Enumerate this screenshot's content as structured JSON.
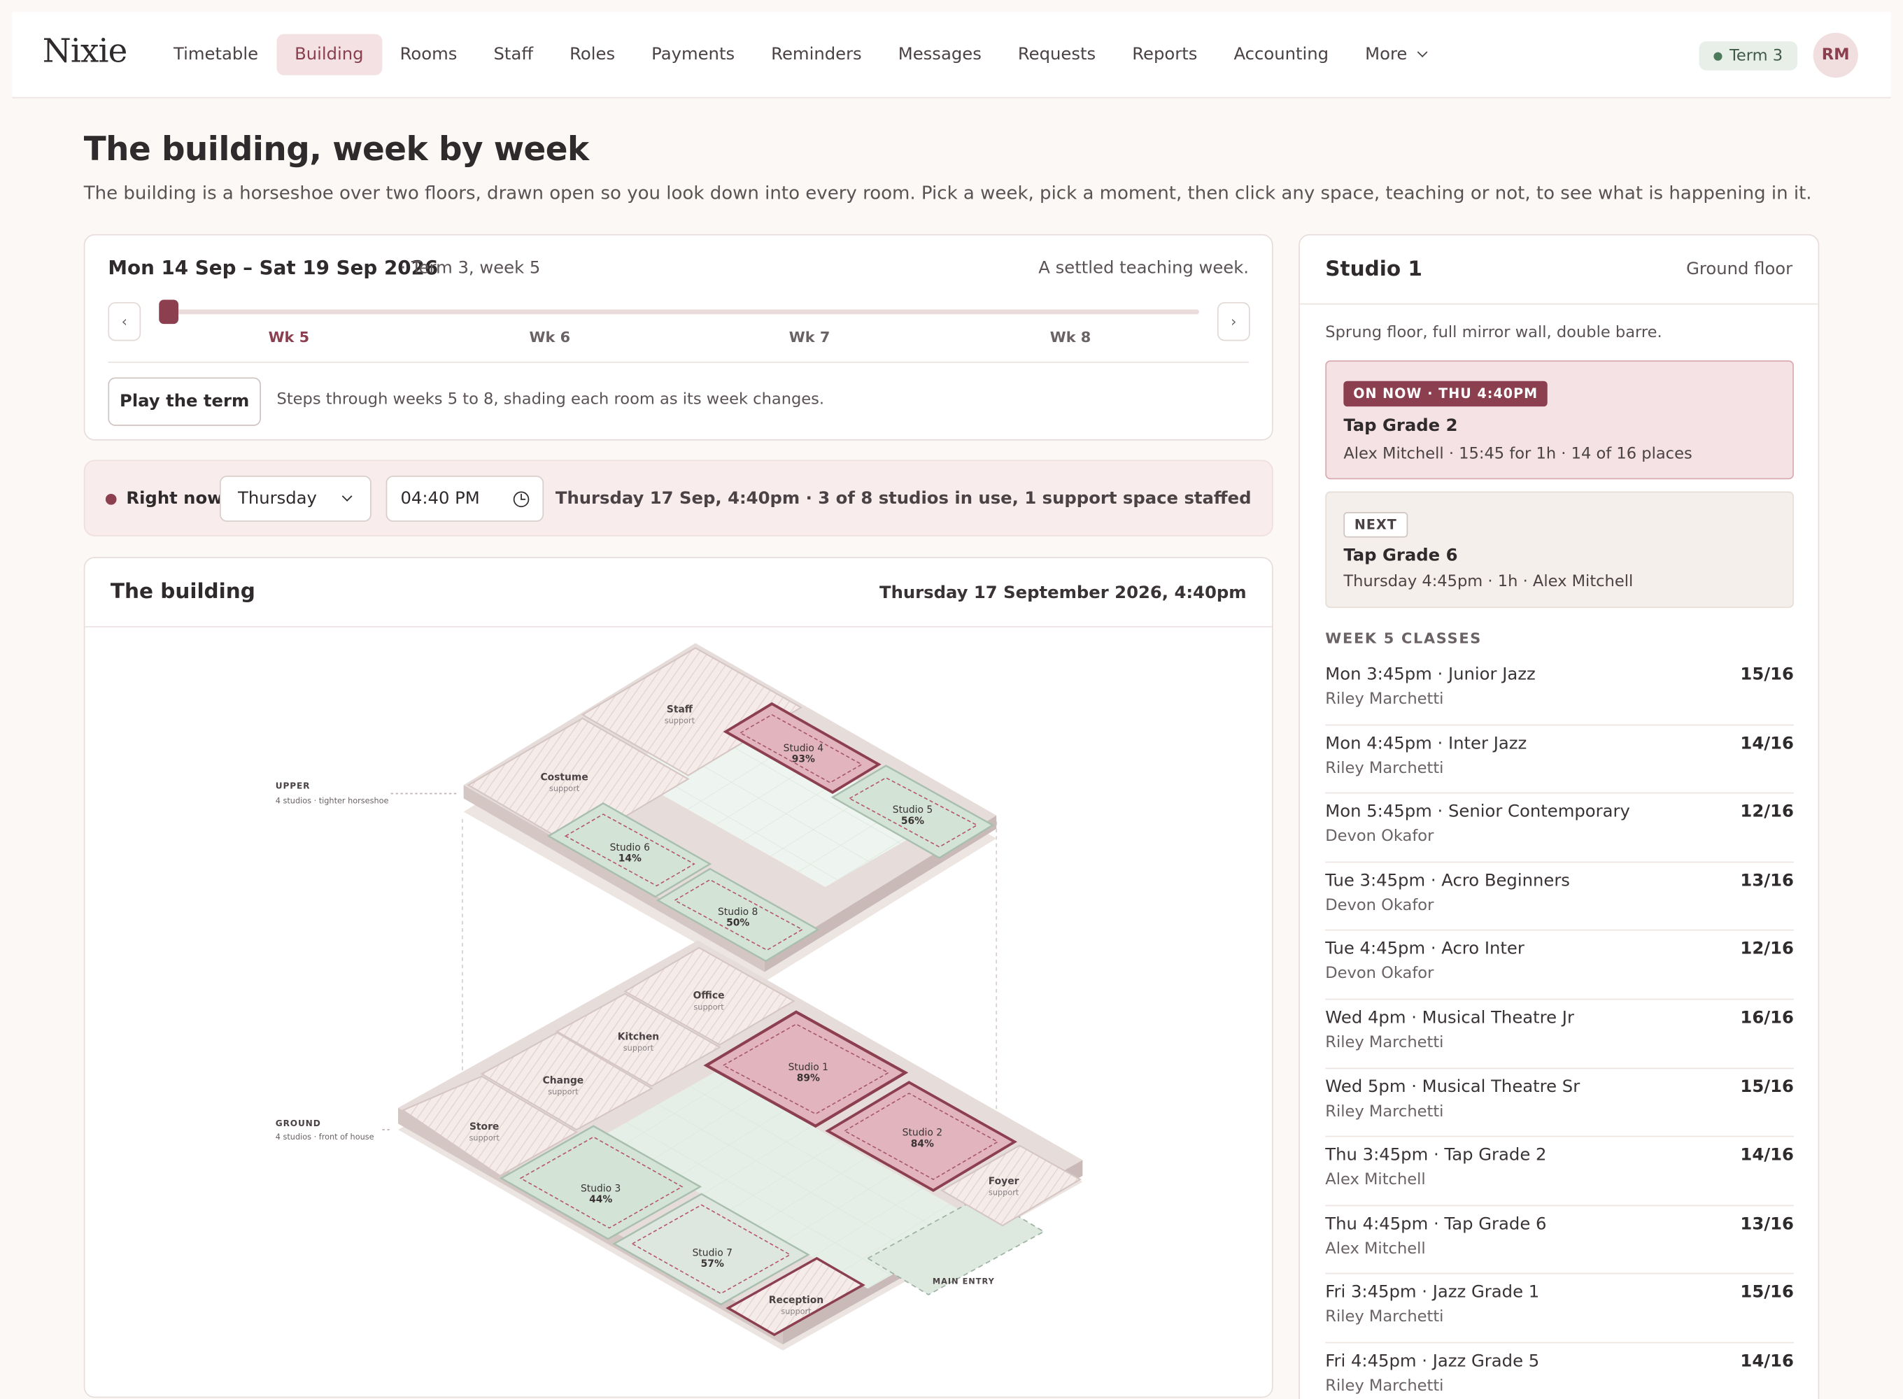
{
  "nav": {
    "brand": "Nixie",
    "items": [
      {
        "label": "Timetable",
        "active": false
      },
      {
        "label": "Building",
        "active": true
      },
      {
        "label": "Rooms",
        "active": false
      },
      {
        "label": "Staff",
        "active": false
      },
      {
        "label": "Roles",
        "active": false
      },
      {
        "label": "Payments",
        "active": false
      },
      {
        "label": "Reminders",
        "active": false
      },
      {
        "label": "Messages",
        "active": false
      },
      {
        "label": "Requests",
        "active": false
      },
      {
        "label": "Reports",
        "active": false
      },
      {
        "label": "Accounting",
        "active": false
      }
    ],
    "more_label": "More",
    "term_badge": "Term 3",
    "avatar_initials": "RM"
  },
  "page": {
    "title": "The building, week by week",
    "subtitle": "The building is a horseshoe over two floors, drawn open so you look down into every room. Pick a week, pick a moment, then click any space, teaching or not, to see what is happening in it."
  },
  "week": {
    "range": "Mon 14 Sep – Sat 19 Sep 2026",
    "term": "· Term 3, week 5",
    "note": "A settled teaching week.",
    "prev_glyph": "‹",
    "next_glyph": "›",
    "labels": [
      "Wk 5",
      "Wk 6",
      "Wk 7",
      "Wk 8"
    ],
    "current_index": 0,
    "play_label": "Play the term",
    "play_note": "Steps through weeks 5 to 8, shading each room as its week changes."
  },
  "now": {
    "label": "Right now",
    "day": "Thursday",
    "time": "04:40 PM",
    "summary": "Thursday 17 Sep, 4:40pm · 3 of 8 studios in use, 1 support space staffed"
  },
  "building": {
    "title": "The building",
    "date": "Thursday 17 September 2026, 4:40pm",
    "upper_label": "UPPER",
    "upper_sub": "4 studios · tighter horseshoe",
    "ground_label": "GROUND",
    "ground_sub": "4 studios · front of house",
    "main_entry": "MAIN ENTRY",
    "rooms": [
      {
        "name": "Staff",
        "sub": "support"
      },
      {
        "name": "Costume",
        "sub": "support"
      },
      {
        "name": "Studio 4",
        "sub": "93%"
      },
      {
        "name": "Studio 5",
        "sub": "56%"
      },
      {
        "name": "Studio 6",
        "sub": "14%"
      },
      {
        "name": "Studio 8",
        "sub": "50%"
      },
      {
        "name": "Office",
        "sub": "support"
      },
      {
        "name": "Kitchen",
        "sub": "support"
      },
      {
        "name": "Change",
        "sub": "support"
      },
      {
        "name": "Store",
        "sub": "support"
      },
      {
        "name": "Studio 1",
        "sub": "89%"
      },
      {
        "name": "Studio 2",
        "sub": "84%"
      },
      {
        "name": "Foyer",
        "sub": "support"
      },
      {
        "name": "Studio 3",
        "sub": "44%"
      },
      {
        "name": "Studio 7",
        "sub": "57%"
      },
      {
        "name": "Reception",
        "sub": "support"
      }
    ]
  },
  "studio": {
    "title": "Studio 1",
    "floor": "Ground floor",
    "description": "Sprung floor, full mirror wall, double barre.",
    "on_now_badge": "ON NOW · THU 4:40PM",
    "on_now_title": "Tap Grade 2",
    "on_now_meta": "Alex Mitchell · 15:45 for 1h · 14 of 16 places",
    "next_badge": "NEXT",
    "next_title": "Tap Grade 6",
    "next_meta": "Thursday 4:45pm · 1h · Alex Mitchell",
    "classes_heading": "WEEK 5 CLASSES",
    "classes": [
      {
        "title": "Mon 3:45pm · Junior Jazz",
        "teacher": "Riley Marchetti",
        "count": "15/16"
      },
      {
        "title": "Mon 4:45pm · Inter Jazz",
        "teacher": "Riley Marchetti",
        "count": "14/16"
      },
      {
        "title": "Mon 5:45pm · Senior Contemporary",
        "teacher": "Devon Okafor",
        "count": "12/16"
      },
      {
        "title": "Tue 3:45pm · Acro Beginners",
        "teacher": "Devon Okafor",
        "count": "13/16"
      },
      {
        "title": "Tue 4:45pm · Acro Inter",
        "teacher": "Devon Okafor",
        "count": "12/16"
      },
      {
        "title": "Wed 4pm · Musical Theatre Jr",
        "teacher": "Riley Marchetti",
        "count": "16/16"
      },
      {
        "title": "Wed 5pm · Musical Theatre Sr",
        "teacher": "Riley Marchetti",
        "count": "15/16"
      },
      {
        "title": "Thu 3:45pm · Tap Grade 2",
        "teacher": "Alex Mitchell",
        "count": "14/16"
      },
      {
        "title": "Thu 4:45pm · Tap Grade 6",
        "teacher": "Alex Mitchell",
        "count": "13/16"
      },
      {
        "title": "Fri 3:45pm · Jazz Grade 1",
        "teacher": "Riley Marchetti",
        "count": "15/16"
      },
      {
        "title": "Fri 4:45pm · Jazz Grade 5",
        "teacher": "Riley Marchetti",
        "count": "14/16"
      }
    ]
  },
  "colors": {
    "accent": "#8b3f4f",
    "busy_fill": "#e6bcc4",
    "calm_fill": "#d7e6da",
    "support_fill": "#f1e6e3"
  }
}
